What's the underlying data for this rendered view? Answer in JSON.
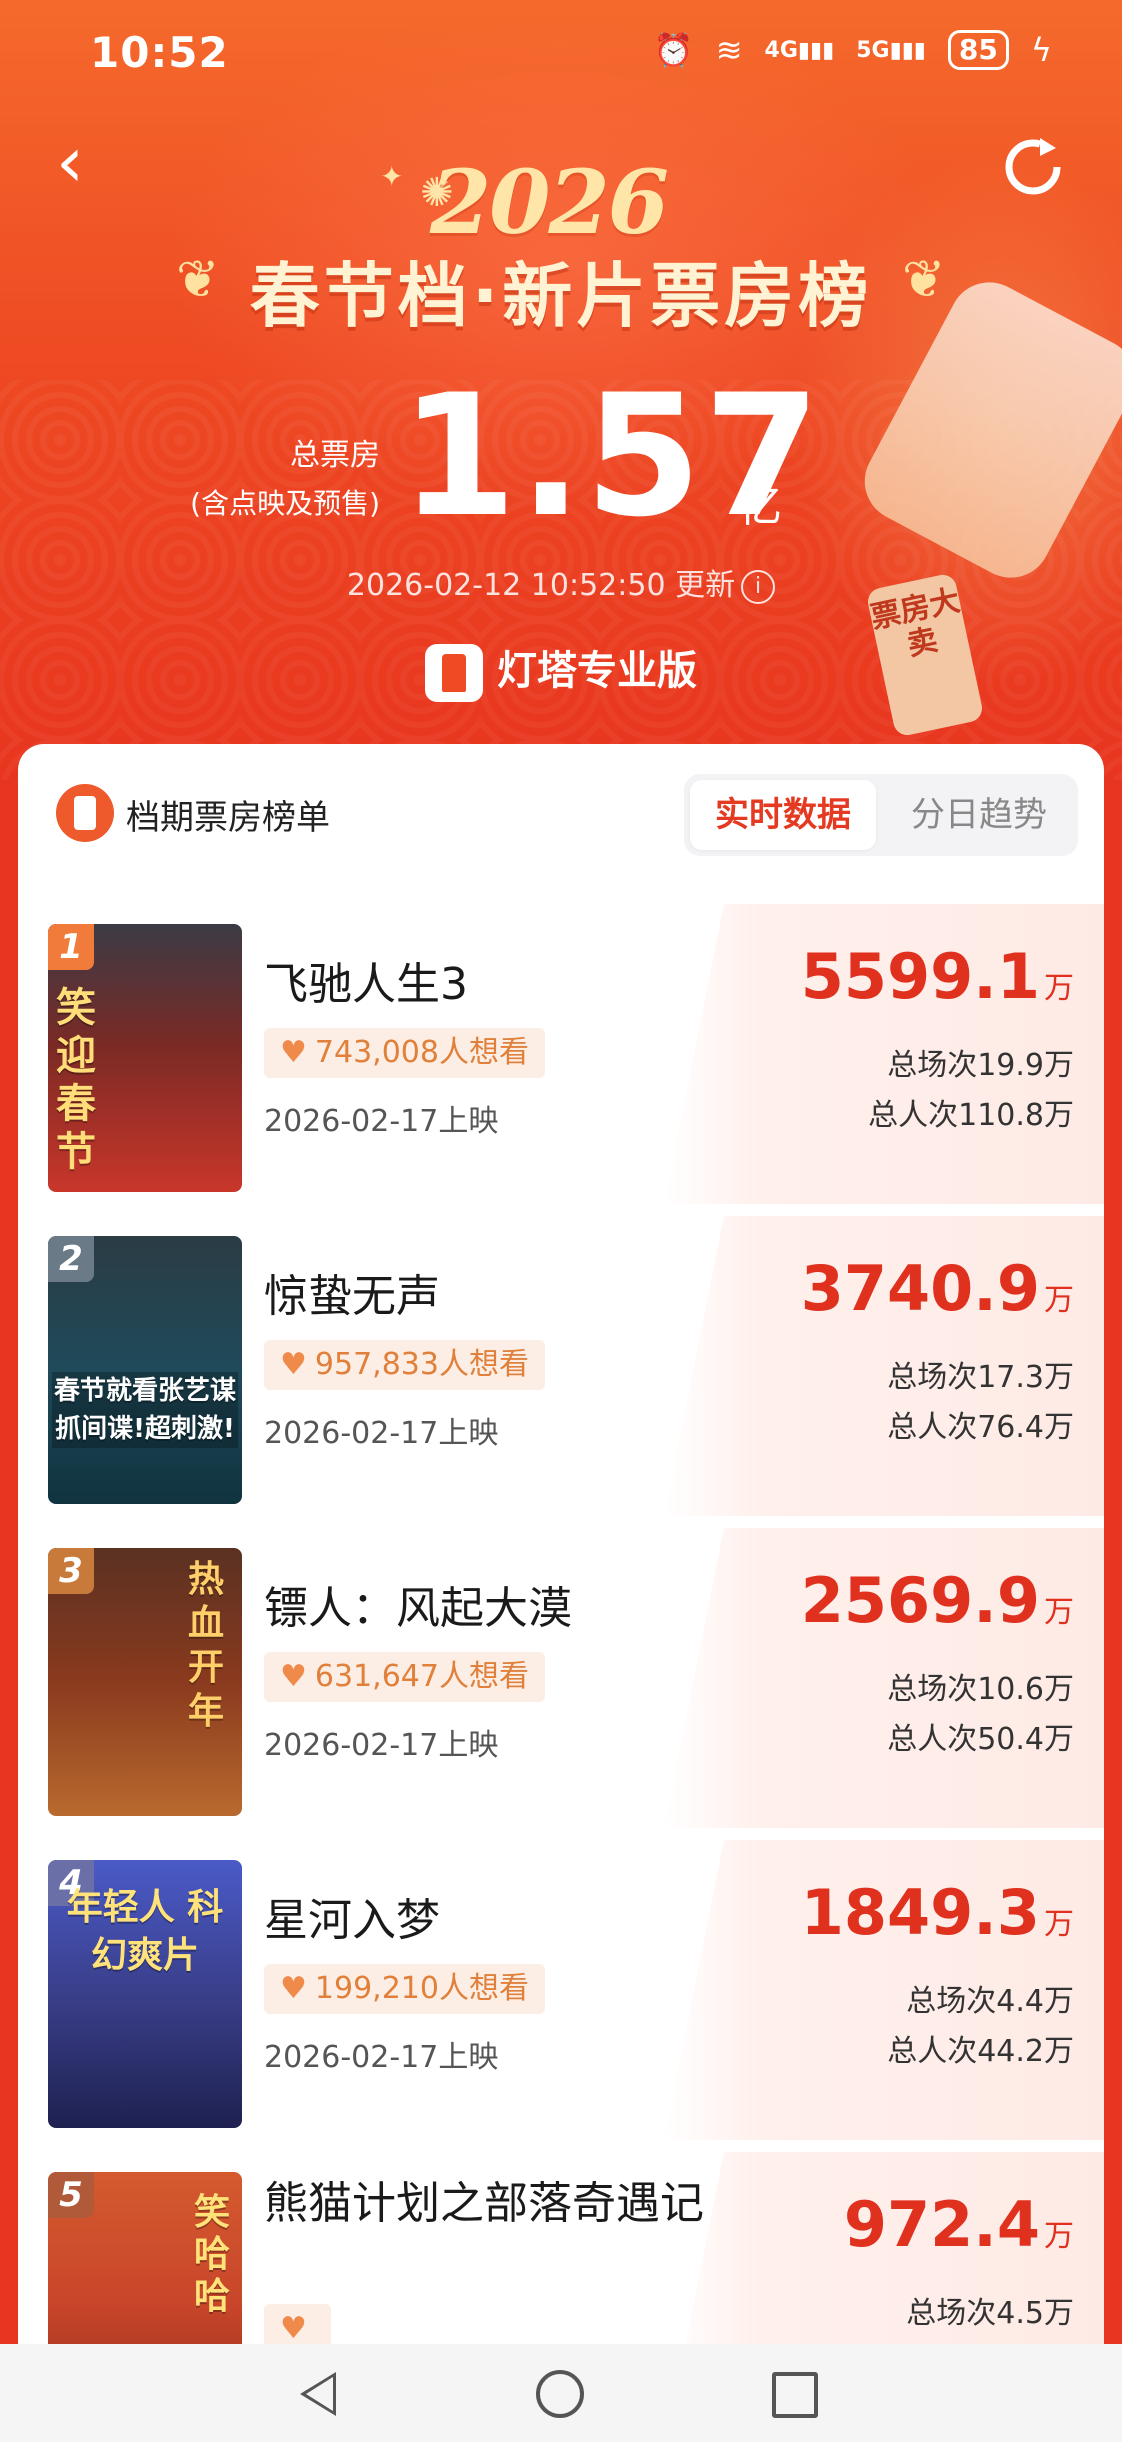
{
  "status_bar": {
    "time": "10:52",
    "battery": "85",
    "signal_1": "4G",
    "signal_2": "5G"
  },
  "header": {
    "year": "2026",
    "title": "春节档·新片票房榜",
    "total_label_1": "总票房",
    "total_label_2": "(含点映及预售)",
    "total_value": "1.57",
    "total_unit": "亿",
    "updated": "2026-02-12 10:52:50 更新",
    "brand": "灯塔专业版",
    "lantern_tag": "票房大卖"
  },
  "list": {
    "title": "档期票房榜单",
    "tabs": [
      "实时数据",
      "分日趋势"
    ],
    "active_tab": "实时数据",
    "colors": {
      "accent": "#e53a22",
      "want": "#e0803a"
    },
    "movies": [
      {
        "rank": "1",
        "name": "飞驰人生3",
        "want": "743,008人想看",
        "release": "2026-02-17上映",
        "box_office": "5599.1",
        "unit": "万",
        "screenings": "总场次19.9万",
        "admissions": "总人次110.8万",
        "poster_text": "笑迎春节",
        "poster_color": "#c9362a"
      },
      {
        "rank": "2",
        "name": "惊蛰无声",
        "want": "957,833人想看",
        "release": "2026-02-17上映",
        "box_office": "3740.9",
        "unit": "万",
        "screenings": "总场次17.3万",
        "admissions": "总人次76.4万",
        "poster_text": "春节就看张艺谋 抓间谍!超刺激!",
        "poster_color": "#1f4a5a"
      },
      {
        "rank": "3",
        "name": "镖人：风起大漠",
        "want": "631,647人想看",
        "release": "2026-02-17上映",
        "box_office": "2569.9",
        "unit": "万",
        "screenings": "总场次10.6万",
        "admissions": "总人次50.4万",
        "poster_text": "热血开年",
        "poster_color": "#8a3a1e"
      },
      {
        "rank": "4",
        "name": "星河入梦",
        "want": "199,210人想看",
        "release": "2026-02-17上映",
        "box_office": "1849.3",
        "unit": "万",
        "screenings": "总场次4.4万",
        "admissions": "总人次44.2万",
        "poster_text": "年轻人 科幻爽片",
        "poster_color": "#3a3f8a"
      },
      {
        "rank": "5",
        "name": "熊猫计划之部落奇遇记",
        "want": "",
        "release": "",
        "box_office": "972.4",
        "unit": "万",
        "screenings": "总场次4.5万",
        "admissions": "",
        "poster_text": "笑哈哈",
        "poster_color": "#c8452a"
      }
    ]
  }
}
